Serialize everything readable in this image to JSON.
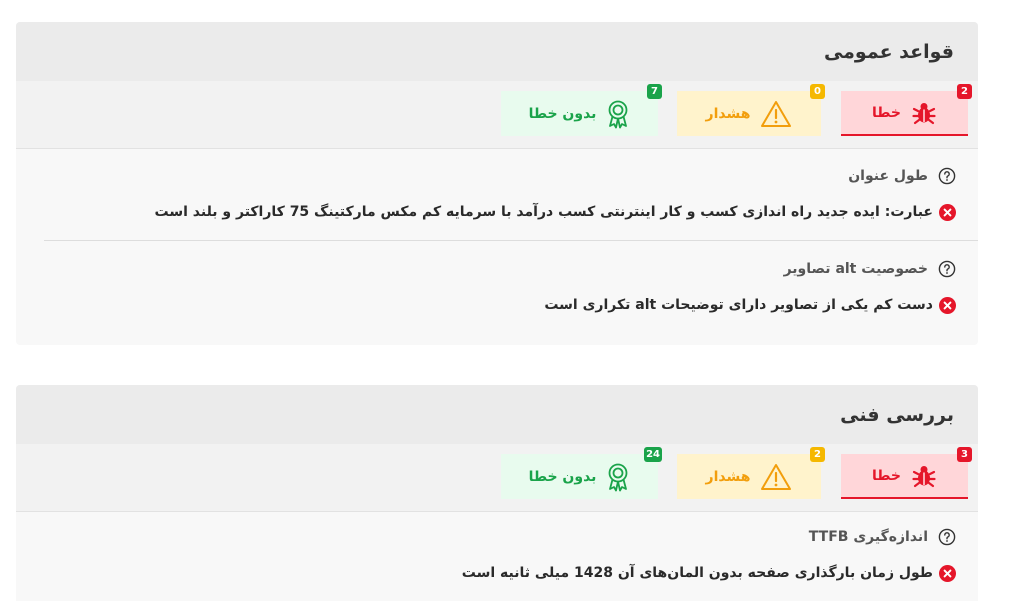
{
  "sections": [
    {
      "title": "قواعد عمومی",
      "tabs": {
        "error": {
          "label": "خطا",
          "count": "2"
        },
        "warning": {
          "label": "هشدار",
          "count": "0"
        },
        "success": {
          "label": "بدون خطا",
          "count": "7"
        }
      },
      "rules": [
        {
          "title": "طول عنوان",
          "message": "عبارت: ایده جدید راه اندازی کسب و کار اینترنتی کسب درآمد با سرمایه کم مکس مارکتینگ 75 کاراکتر و بلند است"
        },
        {
          "title": "خصوصیت alt تصاویر",
          "message": "دست کم یکی از تصاویر دارای توضیحات alt تکراری است"
        }
      ]
    },
    {
      "title": "بررسی فنی",
      "tabs": {
        "error": {
          "label": "خطا",
          "count": "3"
        },
        "warning": {
          "label": "هشدار",
          "count": "2"
        },
        "success": {
          "label": "بدون خطا",
          "count": "24"
        }
      },
      "rules": [
        {
          "title": "اندازه‌گیری TTFB",
          "message": "طول زمان بارگذاری صفحه بدون المان‌های آن 1428 میلی ثانیه است"
        }
      ]
    }
  ],
  "colors": {
    "error": "#e5162a",
    "warning": "#f29e0c",
    "success": "#1aa34a"
  },
  "icons": {
    "error": "bug-icon",
    "warning": "warning-triangle-icon",
    "success": "award-ribbon-icon",
    "help": "question-circle-icon",
    "fail": "x-circle-icon"
  }
}
